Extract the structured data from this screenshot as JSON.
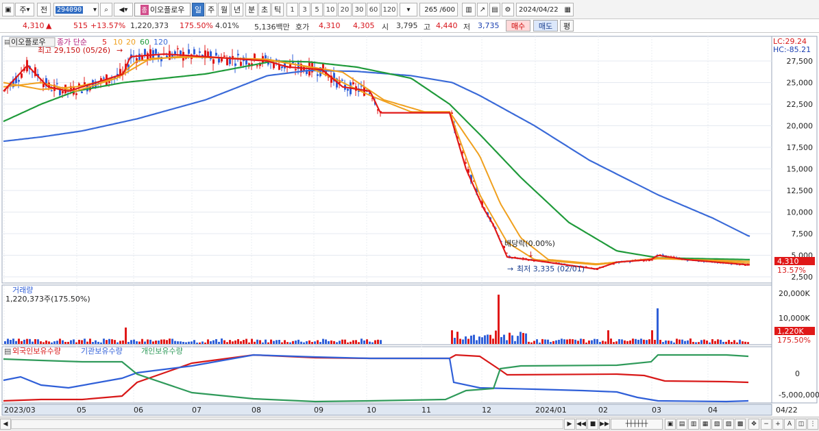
{
  "toolbar": {
    "period_left": "주",
    "prefix": "전",
    "stock_code": "294090",
    "stock_name_badge": "종",
    "stock_name": "이오플로우",
    "periods": [
      "일",
      "주",
      "월",
      "년",
      "분",
      "초",
      "틱"
    ],
    "selected_period": "일",
    "intervals": [
      "1",
      "3",
      "5",
      "10",
      "20",
      "30",
      "60",
      "120"
    ],
    "count": "265 /600",
    "date": "2024/04/22"
  },
  "quote": {
    "price": "4,310",
    "direction": "▲",
    "change": "515",
    "change_pct": "+13.57%",
    "volume": "1,220,373",
    "volume_pct": "175.50%",
    "turnover_pct": "4.01%",
    "amount": "5,136백만",
    "hoga_label": "호가",
    "hoga_ask": "4,310",
    "hoga_bid": "4,305",
    "open_label": "시",
    "open": "3,795",
    "high_label": "고",
    "high": "4,440",
    "low_label": "저",
    "low": "3,735",
    "buy_label": "매수",
    "sell_label": "매도",
    "avg_label": "평"
  },
  "price_panel": {
    "name_tag": "이오플로우",
    "legend_prefix": "종가 단순",
    "ma_periods": [
      "5",
      "10",
      "20",
      "60",
      "120"
    ],
    "ma_colors": [
      "#e01818",
      "#f0a01e",
      "#f0a01e",
      "#1f9a3a",
      "#3a6ad8"
    ],
    "max_note": "최고 29,150 (05/26)",
    "min_note": "최저 3,335 (02/01)",
    "dividend_note": "배당락(0.00%)",
    "lc": "LC:29.24",
    "hc": "HC:-85.21",
    "y_ticks": [
      "27,500",
      "25,000",
      "22,500",
      "20,000",
      "17,500",
      "15,000",
      "12,500",
      "10,000",
      "7,500",
      "5,000",
      "2,500"
    ],
    "last_price_tag": "4,310",
    "last_pct_tag": "13.57%"
  },
  "volume_panel": {
    "title": "거래량",
    "summary": "1,220,373주(175.50%)",
    "y_ticks": [
      "20,000K",
      "10,000K"
    ],
    "last_tag": "1,220K",
    "last_pct_tag": "175.50%"
  },
  "holding_panel": {
    "legend": [
      "외국인보유수량",
      "기관보유수량",
      "개인보유수량"
    ],
    "colors": [
      "#d81818",
      "#2f5fd8",
      "#2f9a5a"
    ],
    "y_ticks": [
      "0",
      "-5,000,000"
    ]
  },
  "x_axis": {
    "labels": [
      "2023/03",
      "05",
      "06",
      "07",
      "08",
      "09",
      "10",
      "11",
      "12",
      "2024/01",
      "02",
      "03",
      "04",
      "04/22"
    ]
  },
  "chart_data": [
    {
      "type": "line",
      "title": "",
      "series_names": [
        "5",
        "10",
        "20",
        "60",
        "120"
      ],
      "x": [
        "2023/03",
        "05",
        "06",
        "07",
        "08",
        "09",
        "10",
        "11",
        "12",
        "2024/01",
        "02",
        "03",
        "04"
      ],
      "ylim": [
        2500,
        28500
      ],
      "series": [
        {
          "name": "5",
          "values": [
            24000,
            26000,
            28000,
            27800,
            27500,
            26500,
            21500,
            21500,
            9500,
            4000,
            4000,
            4500,
            4000
          ]
        },
        {
          "name": "60",
          "values": [
            20500,
            23000,
            25000,
            27000,
            27500,
            27000,
            25500,
            22000,
            17000,
            9500,
            5200,
            4500,
            4300
          ]
        },
        {
          "name": "120",
          "values": [
            18200,
            19500,
            21000,
            23000,
            25800,
            26500,
            26000,
            24500,
            21000,
            16000,
            11500,
            9500,
            7200
          ]
        }
      ]
    },
    {
      "type": "bar",
      "title": "",
      "ylabel": "거래량",
      "notes": "last 1,220K"
    },
    {
      "type": "line",
      "title": "",
      "series_names": [
        "외국인보유수량",
        "기관보유수량",
        "개인보유수량"
      ],
      "ylim": [
        -6000000,
        2000000
      ]
    }
  ]
}
